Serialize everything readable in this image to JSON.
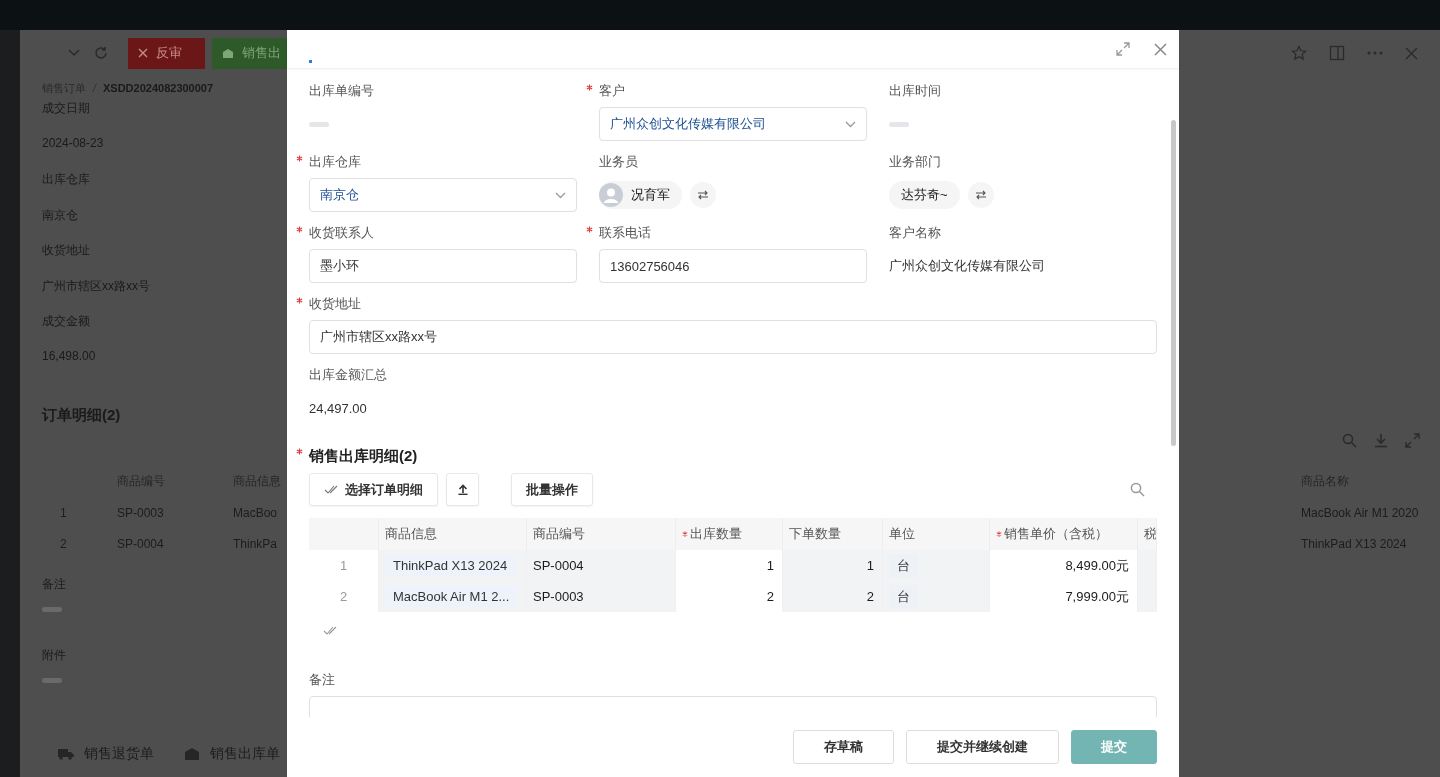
{
  "background_page": {
    "toolbar": [
      {
        "label": "反审",
        "kind": "danger"
      },
      {
        "label": "销售出",
        "kind": "success"
      }
    ],
    "breadcrumb": {
      "parent": "销售订单",
      "current": "XSDD2024082300007"
    },
    "fields": [
      {
        "label": "成交日期",
        "value": "2024-08-23"
      },
      {
        "label": "出库仓库",
        "value": "南京仓"
      },
      {
        "label": "收货地址",
        "value": "广州市辖区xx路xx号"
      },
      {
        "label": "成交金额",
        "value": "16,498.00"
      }
    ],
    "section_title": "订单明细(2)",
    "table": {
      "columns": [
        "商品编号",
        "商品信息",
        "商品名称"
      ],
      "rows": [
        {
          "number": "1",
          "code": "SP-0003",
          "info": "MacBoo",
          "name": "MacBook Air M1 2020"
        },
        {
          "number": "2",
          "code": "SP-0004",
          "info": "ThinkPa",
          "name": "ThinkPad X13 2024"
        }
      ]
    },
    "notes_label": "备注",
    "attachments_label": "附件",
    "footer_buttons": [
      {
        "label": "销售退货单",
        "kind": "truck"
      },
      {
        "label": "销售出库单",
        "kind": "box"
      }
    ]
  },
  "dialog": {
    "fields": [
      {
        "label": "出库单编号",
        "required": false,
        "kind": "empty"
      },
      {
        "label": "客户",
        "required": true,
        "kind": "select",
        "value": "广州众创文化传媒有限公司"
      },
      {
        "label": "出库时间",
        "required": false,
        "kind": "empty"
      },
      {
        "label": "出库仓库",
        "required": true,
        "kind": "select",
        "value": "南京仓"
      },
      {
        "label": "业务员",
        "required": false,
        "kind": "member",
        "value": "况育军"
      },
      {
        "label": "业务部门",
        "required": false,
        "kind": "department",
        "value": "达芬奇~"
      },
      {
        "label": "收货联系人",
        "required": true,
        "kind": "input",
        "value": "墨小环"
      },
      {
        "label": "联系电话",
        "required": true,
        "kind": "input",
        "value": "13602756046"
      },
      {
        "label": "客户名称",
        "required": false,
        "kind": "text",
        "value": "广州众创文化传媒有限公司"
      },
      {
        "label": "收货地址",
        "required": true,
        "kind": "wide-input",
        "value": "广州市辖区xx路xx号"
      },
      {
        "label": "出库金额汇总",
        "required": false,
        "kind": "wide-text",
        "value": "24,497.00"
      }
    ],
    "detail": {
      "title": "销售出库明细(2)",
      "required": true,
      "toolbar": [
        {
          "kind": "select",
          "label": "选择订单明细"
        },
        {
          "kind": "upload"
        },
        {
          "kind": "batch",
          "label": "批量操作"
        }
      ],
      "columns": [
        {
          "label": "商品信息",
          "required": false,
          "editable": false,
          "kind": "tag"
        },
        {
          "label": "商品编号",
          "required": false,
          "editable": false,
          "kind": "text"
        },
        {
          "label": "出库数量",
          "required": true,
          "editable": true,
          "kind": "number"
        },
        {
          "label": "下单数量",
          "required": false,
          "editable": false,
          "kind": "number"
        },
        {
          "label": "单位",
          "required": false,
          "editable": false,
          "kind": "unit"
        },
        {
          "label": "销售单价（含税）",
          "required": true,
          "editable": true,
          "kind": "number"
        },
        {
          "label": "税",
          "required": false,
          "editable": false,
          "kind": "text"
        }
      ],
      "rows": [
        {
          "number": "1",
          "cells": [
            "ThinkPad X13 2024",
            "SP-0004",
            "1",
            "1",
            "台",
            "8,499.00元"
          ]
        },
        {
          "number": "2",
          "cells": [
            "MacBook Air M1 2...",
            "SP-0003",
            "2",
            "2",
            "台",
            "7,999.00元"
          ]
        }
      ]
    },
    "remark_label": "备注",
    "footer_buttons": [
      {
        "label": "存草稿",
        "kind": "default"
      },
      {
        "label": "提交并继续创建",
        "kind": "default"
      },
      {
        "label": "提交",
        "kind": "primary"
      }
    ]
  }
}
